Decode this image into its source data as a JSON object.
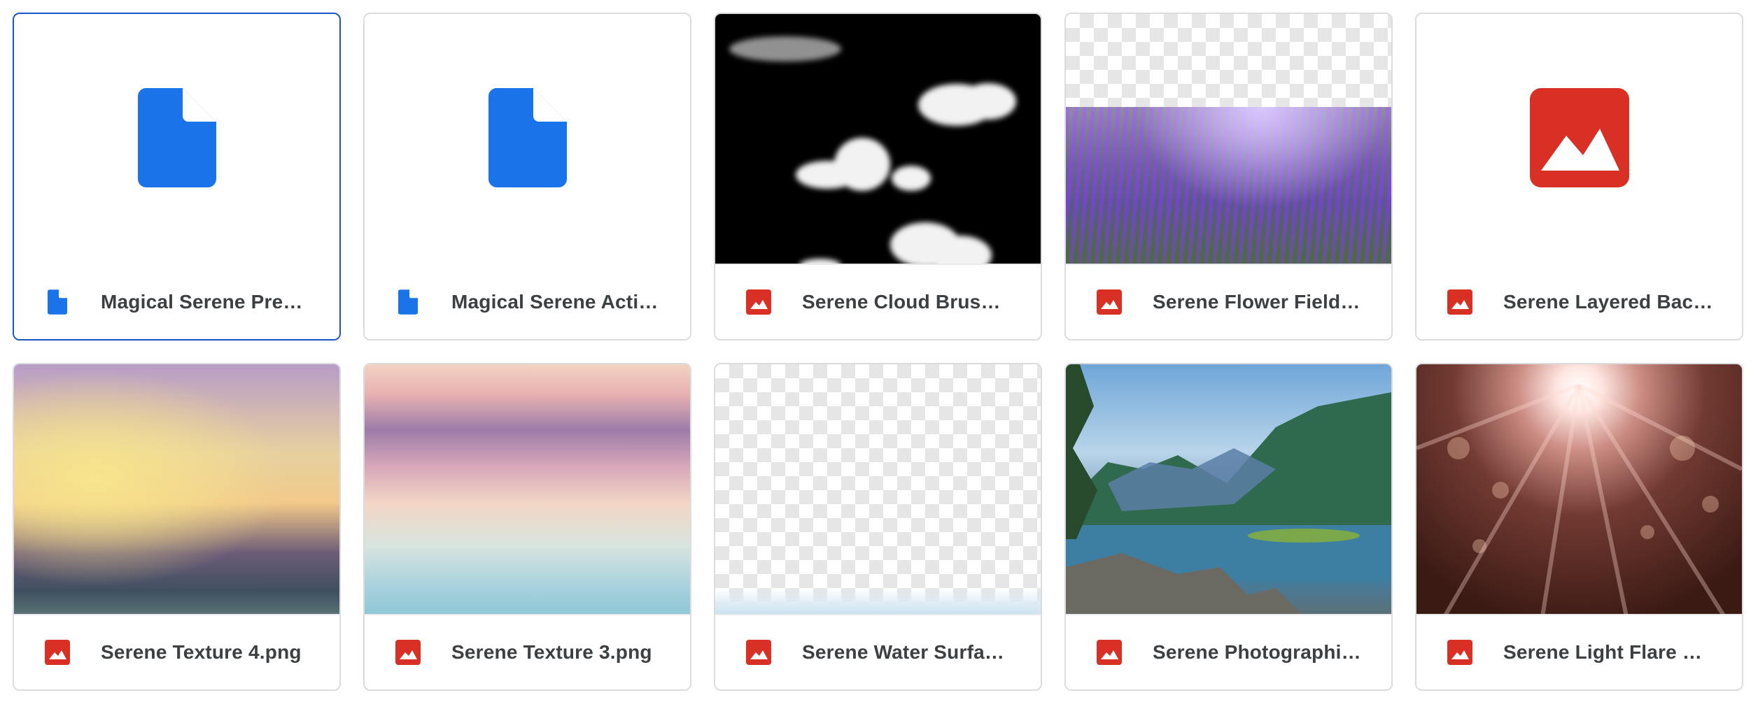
{
  "files": [
    {
      "name": "Magical Serene Preset...",
      "type": "doc",
      "selected": true,
      "thumb": "blank"
    },
    {
      "name": "Magical Serene Action...",
      "type": "doc",
      "selected": false,
      "thumb": "blank"
    },
    {
      "name": "Serene Cloud Brush Sa...",
      "type": "image",
      "selected": false,
      "thumb": "clouds"
    },
    {
      "name": "Serene Flower Field Ov...",
      "type": "image",
      "selected": false,
      "thumb": "lavender"
    },
    {
      "name": "Serene Layered Backgr...",
      "type": "image",
      "selected": false,
      "thumb": "blank-image"
    },
    {
      "name": "Serene Texture 4.png",
      "type": "image",
      "selected": false,
      "thumb": "tex4"
    },
    {
      "name": "Serene Texture 3.png",
      "type": "image",
      "selected": false,
      "thumb": "tex3"
    },
    {
      "name": "Serene Water Surface ...",
      "type": "image",
      "selected": false,
      "thumb": "water"
    },
    {
      "name": "Serene Photographic B...",
      "type": "image",
      "selected": false,
      "thumb": "mountains"
    },
    {
      "name": "Serene Light Flare Ove...",
      "type": "image",
      "selected": false,
      "thumb": "flare"
    }
  ],
  "colors": {
    "doc_icon": "#1a73e8",
    "image_icon": "#d93025",
    "selected_border": "#1a56c9"
  },
  "icons": {
    "doc": "document-icon",
    "image": "image-icon"
  }
}
